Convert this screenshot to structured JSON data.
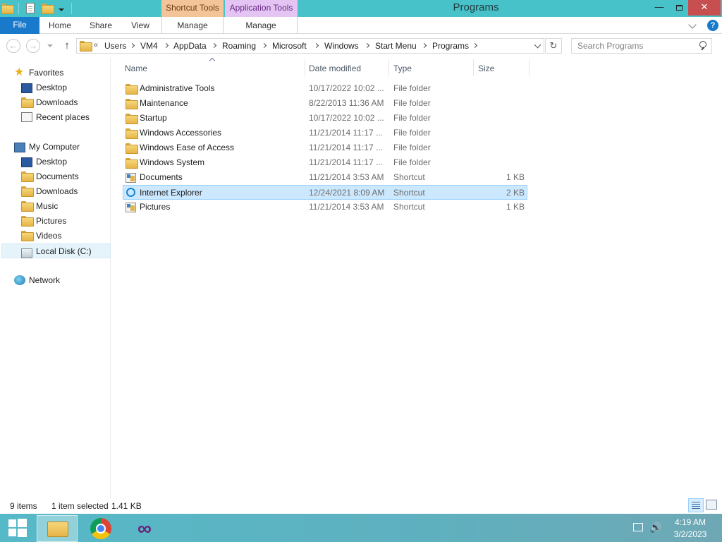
{
  "window": {
    "title": "Programs",
    "minimize": "—",
    "close": "✕"
  },
  "ribbon": {
    "contextual": [
      {
        "group": "Shortcut Tools",
        "tab": "Manage",
        "color": "#f4c499"
      },
      {
        "group": "Application Tools",
        "tab": "Manage",
        "color": "#e3c4f2"
      }
    ],
    "file_tab": "File",
    "tabs": [
      "Home",
      "Share",
      "View"
    ],
    "accent": "#1979ca",
    "help": "?"
  },
  "address": {
    "overflow": "«",
    "breadcrumbs": [
      "Users",
      "VM4",
      "AppData",
      "Roaming",
      "Microsoft",
      "Windows",
      "Start Menu",
      "Programs"
    ],
    "refresh": "↻",
    "up": "↑"
  },
  "search": {
    "placeholder": "Search Programs"
  },
  "nav_pane": {
    "favorites": {
      "label": "Favorites",
      "items": [
        "Desktop",
        "Downloads",
        "Recent places"
      ]
    },
    "computer": {
      "label": "My Computer",
      "items": [
        "Desktop",
        "Documents",
        "Downloads",
        "Music",
        "Pictures",
        "Videos",
        "Local Disk (C:)"
      ],
      "selected": "Local Disk (C:)"
    },
    "network": {
      "label": "Network"
    }
  },
  "columns": {
    "name": "Name",
    "date": "Date modified",
    "type": "Type",
    "size": "Size"
  },
  "files": [
    {
      "name": "Administrative Tools",
      "date": "10/17/2022 10:02 ...",
      "type": "File folder",
      "size": "",
      "icon": "folder-icon"
    },
    {
      "name": "Maintenance",
      "date": "8/22/2013 11:36 AM",
      "type": "File folder",
      "size": "",
      "icon": "folder-icon"
    },
    {
      "name": "Startup",
      "date": "10/17/2022 10:02 ...",
      "type": "File folder",
      "size": "",
      "icon": "folder-icon"
    },
    {
      "name": "Windows Accessories",
      "date": "11/21/2014 11:17 ...",
      "type": "File folder",
      "size": "",
      "icon": "folder-icon"
    },
    {
      "name": "Windows Ease of Access",
      "date": "11/21/2014 11:17 ...",
      "type": "File folder",
      "size": "",
      "icon": "folder-icon"
    },
    {
      "name": "Windows System",
      "date": "11/21/2014 11:17 ...",
      "type": "File folder",
      "size": "",
      "icon": "folder-icon"
    },
    {
      "name": "Documents",
      "date": "11/21/2014 3:53 AM",
      "type": "Shortcut",
      "size": "1 KB",
      "icon": "shortcut-icon"
    },
    {
      "name": "Internet Explorer",
      "date": "12/24/2021 8:09 AM",
      "type": "Shortcut",
      "size": "2 KB",
      "icon": "ie-shortcut-icon",
      "selected": true
    },
    {
      "name": "Pictures",
      "date": "11/21/2014 3:53 AM",
      "type": "Shortcut",
      "size": "1 KB",
      "icon": "shortcut-icon"
    }
  ],
  "status": {
    "items": "9 items",
    "selected": "1 item selected",
    "size": "1.41 KB"
  },
  "taskbar": {
    "apps": [
      "file-explorer-icon",
      "chrome-icon",
      "visual-studio-icon"
    ],
    "time": "4:19 AM",
    "date": "3/2/2023"
  }
}
